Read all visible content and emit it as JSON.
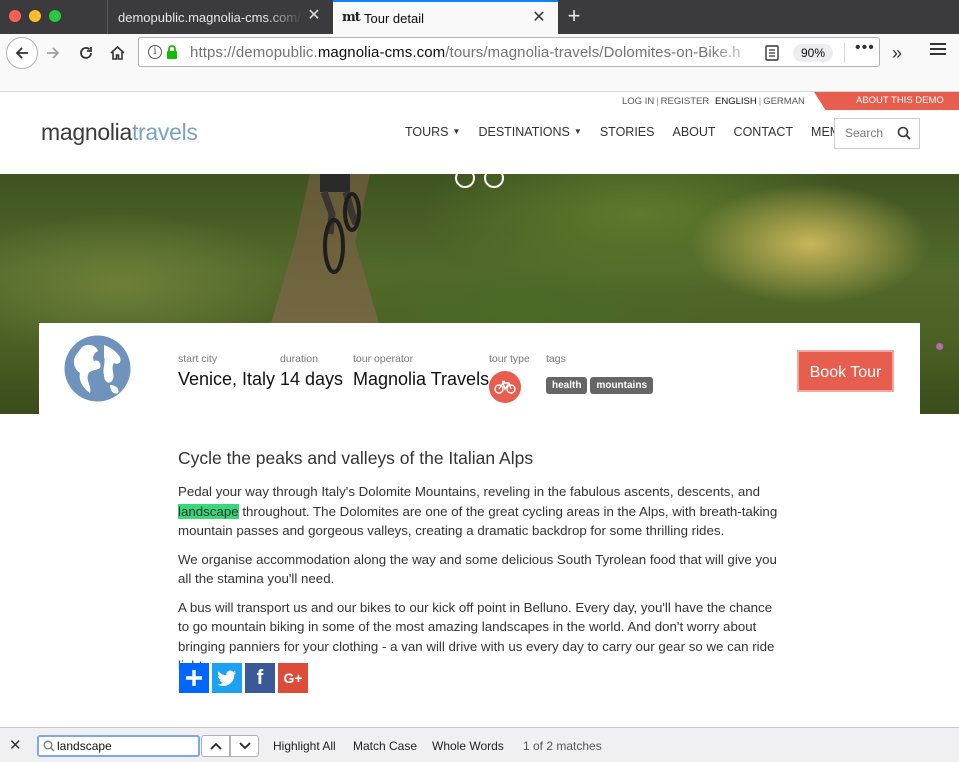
{
  "browser": {
    "tabs": [
      {
        "title": "demopublic.magnolia-cms.com/.res",
        "active": false
      },
      {
        "title": "Tour detail",
        "favicon": "mt",
        "active": true
      }
    ],
    "url_prefix": "https://demopublic.",
    "url_domain": "magnolia-cms.com",
    "url_path": "/tours/magnolia-travels/Dolomites-on-Bike.h",
    "zoom": "90%"
  },
  "site": {
    "util": {
      "login": "LOG IN",
      "register": "REGISTER"
    },
    "lang": {
      "english": "ENGLISH",
      "german": "GERMAN"
    },
    "about_demo": "ABOUT THIS DEMO",
    "logo": {
      "dark": "magnolia",
      "light": "travels"
    },
    "nav": [
      "TOURS",
      "DESTINATIONS",
      "STORIES",
      "ABOUT",
      "CONTACT",
      "MEMBERS"
    ],
    "search_placeholder": "Search"
  },
  "tour": {
    "start_city_label": "start city",
    "start_city": "Venice, Italy",
    "duration_label": "duration",
    "duration": "14 days",
    "operator_label": "tour operator",
    "operator": "Magnolia Travels",
    "type_label": "tour type",
    "type_icon": "bicycle-icon",
    "tags_label": "tags",
    "tags": [
      "health",
      "mountains"
    ],
    "book_label": "Book Tour"
  },
  "article": {
    "heading": "Cycle the peaks and valleys of the Italian Alps",
    "p1_before": "Pedal your way through Italy's Dolomite Mountains, reveling in the fabulous ascents, descents, and ",
    "p1_highlight": "landscape",
    "p1_after": " throughout.  The Dolomites are one of the great cycling areas in the Alps, with breath-taking mountain passes and gorgeous valleys, creating a dramatic backdrop for some thrilling rides.",
    "p2": "We organise accommodation along the way and some delicious South Tyrolean food that will give you all the stamina you'll need.",
    "p3": "A bus will transport us and our bikes to our kick off point in Belluno. Every day, you'll have the chance to go mountain biking in some of the most amazing landscapes in the world. And don't worry about bringing panniers for your clothing - a van will drive with us every day to carry our gear so we can ride light."
  },
  "share": {
    "facebook": "f",
    "googleplus": "G+"
  },
  "findbar": {
    "query": "landscape",
    "highlight_all": "Highlight All",
    "match_case": "Match Case",
    "whole_words": "Whole Words",
    "status": "1 of 2 matches"
  },
  "colors": {
    "accent": "#e75e4e",
    "link_blue": "#0a84ff",
    "highlight": "#38d878",
    "logo_light": "#7aa2c1"
  }
}
